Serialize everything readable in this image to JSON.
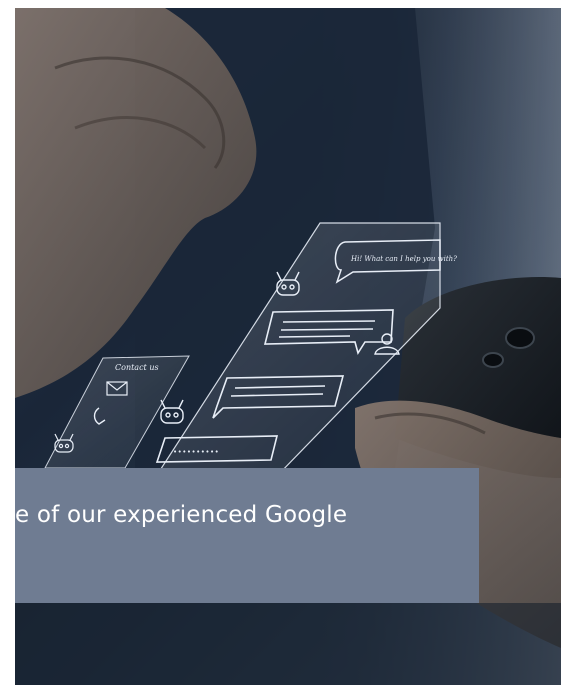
{
  "hero": {
    "chat_bubble_text": "Hi! What can I help you with?",
    "contact_panel_label": "Contact us",
    "typing_dots": "••••••••••",
    "caption_text": "e of our experienced Google"
  },
  "colors": {
    "background_dark": "#1d2a3d",
    "caption_box": "#6f7c92",
    "caption_text": "#ffffff",
    "hologram_lines": "#e8eef7"
  },
  "icons": [
    "robot-icon",
    "envelope-icon",
    "phone-icon",
    "user-icon"
  ]
}
